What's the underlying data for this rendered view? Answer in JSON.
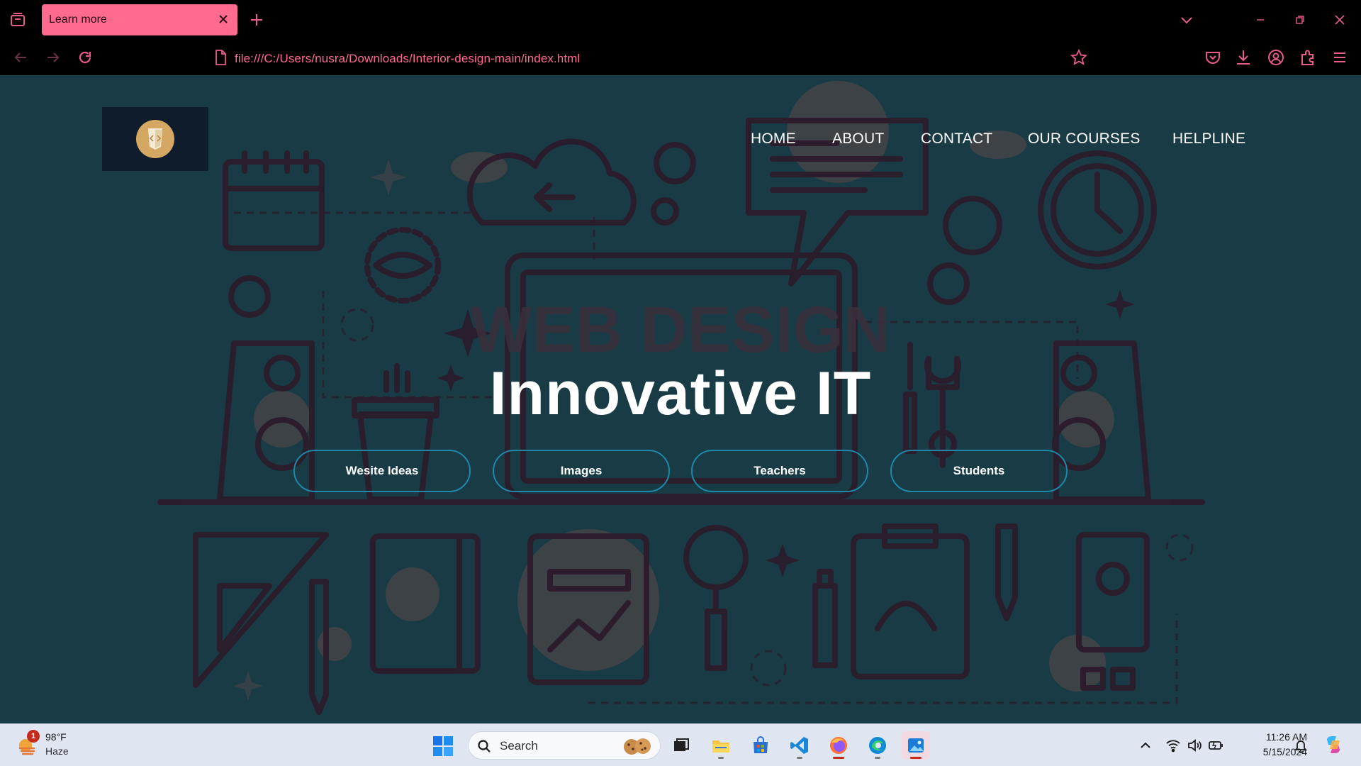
{
  "browser": {
    "tab_title": "Learn more",
    "url": "file:///C:/Users/nusra/Downloads/Interior-design-main/index.html"
  },
  "site": {
    "nav": [
      "HOME",
      "ABOUT",
      "CONTACT",
      "OUR COURSES",
      "HELPLINE"
    ],
    "hero_title": "Innovative IT",
    "buttons": [
      "Wesite Ideas",
      "Images",
      "Teachers",
      "Students"
    ],
    "background_text": "WEB DESIGN"
  },
  "taskbar": {
    "weather": {
      "temp": "98°F",
      "desc": "Haze",
      "badge": "1"
    },
    "search_label": "Search",
    "clock": {
      "time": "11:26 AM",
      "date": "5/15/2024"
    }
  },
  "colors": {
    "accent": "#ff6b8f",
    "page_bg": "#183b45",
    "pill_border": "#1f87a8",
    "logo_gold": "#d4a762"
  },
  "icons": {
    "browser": [
      "tab-list-icon",
      "close-icon",
      "plus-icon",
      "chevron-down-icon",
      "minimize-icon",
      "restore-icon",
      "back-icon",
      "forward-icon",
      "reload-icon",
      "page-icon",
      "star-icon",
      "pocket-icon",
      "download-icon",
      "account-icon",
      "extensions-icon",
      "menu-icon"
    ],
    "taskbar_apps": [
      "task-view-icon",
      "file-explorer-icon",
      "store-icon",
      "vscode-icon",
      "firefox-icon",
      "edge-icon",
      "photos-icon"
    ]
  }
}
